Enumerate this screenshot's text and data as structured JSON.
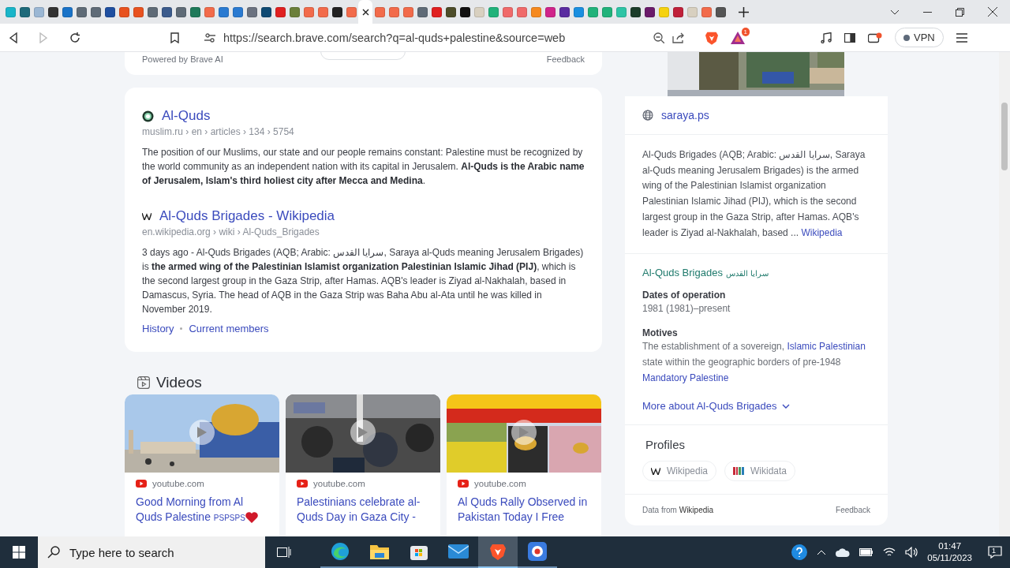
{
  "tabs": [
    {
      "color": "#19b5c9",
      "selected": false
    },
    {
      "color": "#1e6a7a",
      "selected": false
    },
    {
      "color": "#9bb7d4",
      "selected": false
    },
    {
      "color": "#333333",
      "selected": false
    },
    {
      "color": "#1a73c8",
      "selected": false
    },
    {
      "color": "#5f6b77",
      "selected": false
    },
    {
      "color": "#5f6b77",
      "selected": false
    },
    {
      "color": "#1f4fa0",
      "selected": false
    },
    {
      "color": "#e8521f",
      "selected": false
    },
    {
      "color": "#e8521f",
      "selected": false
    },
    {
      "color": "#5f6b77",
      "selected": false
    },
    {
      "color": "#3b5b8c",
      "selected": false
    },
    {
      "color": "#5f6b77",
      "selected": false
    },
    {
      "color": "#1f7a5a",
      "selected": false
    },
    {
      "color": "#f26b4b",
      "selected": false
    },
    {
      "color": "#2a7ad1",
      "selected": false
    },
    {
      "color": "#2a7ad1",
      "selected": false
    },
    {
      "color": "#6b7280",
      "selected": false
    },
    {
      "color": "#0f4a73",
      "selected": false
    },
    {
      "color": "#e02020",
      "selected": false
    },
    {
      "color": "#6b7f3a",
      "selected": false
    },
    {
      "color": "#f26b4b",
      "selected": false
    },
    {
      "color": "#f26b4b",
      "selected": false
    },
    {
      "color": "#222222",
      "selected": false
    },
    {
      "color": "#f26b4b",
      "selected": false
    },
    {
      "selected": true
    },
    {
      "color": "#f26b4b",
      "selected": false
    },
    {
      "color": "#f26b4b",
      "selected": false
    },
    {
      "color": "#f26b4b",
      "selected": false
    },
    {
      "color": "#5f6b77",
      "selected": false
    },
    {
      "color": "#e02020",
      "selected": false
    },
    {
      "color": "#4d4d2a",
      "selected": false
    },
    {
      "color": "#111111",
      "selected": false
    },
    {
      "color": "#d8d0c0",
      "selected": false
    },
    {
      "color": "#21b27a",
      "selected": false
    },
    {
      "color": "#f06a6a",
      "selected": false
    },
    {
      "color": "#f06a6a",
      "selected": false
    },
    {
      "color": "#f5891f",
      "selected": false
    },
    {
      "color": "#d0248a",
      "selected": false
    },
    {
      "color": "#5a2ca0",
      "selected": false
    },
    {
      "color": "#1a8fe0",
      "selected": false
    },
    {
      "color": "#21b27a",
      "selected": false
    },
    {
      "color": "#21b27a",
      "selected": false
    },
    {
      "color": "#2ec4a5",
      "selected": false
    },
    {
      "color": "#1c3d2a",
      "selected": false
    },
    {
      "color": "#6a1b6a",
      "selected": false
    },
    {
      "color": "#f5d20f",
      "selected": false
    },
    {
      "color": "#c0213a",
      "selected": false
    },
    {
      "color": "#d8d0c0",
      "selected": false
    },
    {
      "color": "#f26b4b",
      "selected": false
    },
    {
      "color": "#555555",
      "selected": false
    }
  ],
  "address_bar": {
    "url": "https://search.brave.com/search?q=al-quds+palestine&source=web",
    "rewards_badge": "1",
    "vpn": "VPN"
  },
  "top_card": {
    "powered_by": "Powered by Brave AI",
    "feedback": "Feedback"
  },
  "results": [
    {
      "kind": "globe",
      "title": "Al-Quds",
      "breadcrumb": "muslim.ru › en › articles › 134 › 5754",
      "description": "The position of our Muslims, our state and our people remains constant: Palestine must be recognized by the world community as an independent nation with its capital in Jerusalem. **Al-Quds is the Arabic name of Jerusalem, Islam's third holiest city after Mecca and Medina**."
    },
    {
      "kind": "wiki",
      "title": "Al-Quds Brigades - Wikipedia",
      "breadcrumb": "en.wikipedia.org › wiki › Al-Quds_Brigades",
      "description": "3 days ago - Al-Quds Brigades (AQB; Arabic: سرايا القدس, Saraya al-Quds meaning Jerusalem Brigades) is **the armed wing of the Palestinian Islamist organization Palestinian Islamic Jihad (PIJ)**, which is the second largest group in the Gaza Strip, after Hamas. AQB's leader is Ziyad al-Nakhalah, based in Damascus, Syria. The head of AQB in the Gaza Strip was Baha Abu al-Ata until he was killed in November 2019.",
      "links": [
        "History",
        "Current members"
      ]
    }
  ],
  "videos": {
    "heading": "Videos",
    "items": [
      {
        "source": "youtube.com",
        "title": "Good Morning from Al Quds Palestine",
        "suffix": "PSPSPS"
      },
      {
        "source": "youtube.com",
        "title": "Palestinians celebrate al-Quds Day in Gaza City -"
      },
      {
        "source": "youtube.com",
        "title": "Al Quds Rally Observed in Pakistan Today I Free"
      }
    ]
  },
  "infobox": {
    "website": "saraya.ps",
    "summary": "Al-Quds Brigades (AQB; Arabic: سرايا القدس, Saraya al-Quds meaning Jerusalem Brigades) is the armed wing of the Palestinian Islamist organization Palestinian Islamic Jihad (PIJ), which is the second largest group in the Gaza Strip, after Hamas. AQB's leader is Ziyad al-Nakhalah, based ...",
    "summary_link": "Wikipedia",
    "name": "Al-Quds Brigades",
    "name_native": "سرايا القدس",
    "facts": [
      {
        "label": "Dates of operation",
        "parts": [
          {
            "text": "1981 (1981)–present",
            "link": false
          }
        ]
      },
      {
        "label": "Motives",
        "parts": [
          {
            "text": "The establishment of a sovereign, ",
            "link": false
          },
          {
            "text": "Islamic Palestinian",
            "link": true
          },
          {
            "text": " state within the geographic borders of pre-1948 ",
            "link": false
          },
          {
            "text": "Mandatory Palestine",
            "link": true
          }
        ]
      }
    ],
    "more": "More about Al-Quds Brigades",
    "profiles_heading": "Profiles",
    "profiles": [
      {
        "kind": "wikipedia",
        "label": "Wikipedia"
      },
      {
        "kind": "wikidata",
        "label": "Wikidata"
      }
    ],
    "data_from": "Data from",
    "data_source": "Wikipedia",
    "feedback": "Feedback"
  },
  "taskbar": {
    "search_placeholder": "Type here to search",
    "apps": [
      {
        "kind": "edge",
        "selected": false
      },
      {
        "kind": "folder",
        "selected": false
      },
      {
        "kind": "store",
        "selected": false
      },
      {
        "kind": "mail",
        "selected": false
      },
      {
        "kind": "brave",
        "selected": true
      },
      {
        "kind": "recorder",
        "selected": false
      }
    ],
    "time": "01:47",
    "date": "05/11/2023",
    "notification_count": "1"
  }
}
